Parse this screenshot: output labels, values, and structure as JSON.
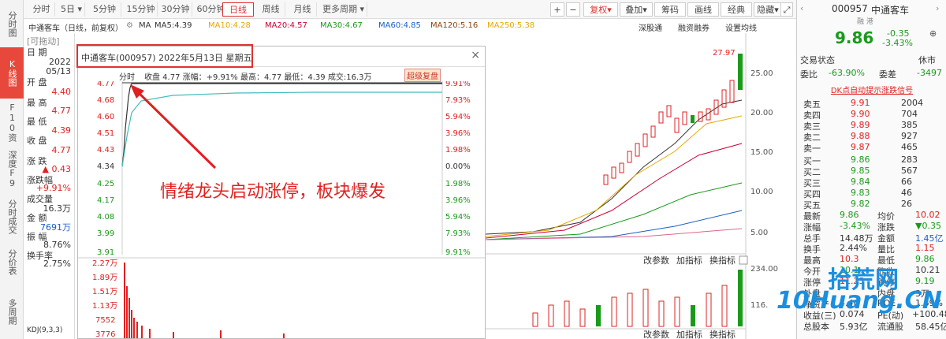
{
  "left_nav": [
    {
      "label": "分时图"
    },
    {
      "label": "K线图",
      "active": true
    },
    {
      "label": "F10资料"
    },
    {
      "label": "深度F9"
    },
    {
      "label": "分时成交"
    },
    {
      "label": "分价表"
    },
    {
      "label": "多周期"
    }
  ],
  "toolbar": {
    "periods": [
      "分时",
      "5日",
      "5分钟",
      "15分钟",
      "30分钟",
      "60分钟",
      "日线",
      "周线",
      "月线",
      "更多周期"
    ],
    "right": [
      "+",
      "−",
      "复权",
      "叠加",
      "筹码",
      "画线",
      "经典",
      "隐藏"
    ]
  },
  "indicator_row": {
    "title": "中通客车（日线，前复权）",
    "ma_label": "MA",
    "ma5": "MA5:4.39",
    "ma10": "MA10:4.28",
    "ma20": "MA20:4.57",
    "ma30": "MA30:4.67",
    "ma60": "MA60:4.85",
    "ma120": "MA120:5.16",
    "ma250": "MA250:5.38",
    "links": [
      "深股通",
      "融资融券",
      "设置均线"
    ]
  },
  "info": {
    "drag": "[可拖动]",
    "date_label": "日  期",
    "date_year": "2022",
    "date_md": "05/13",
    "open_label": "开  盘",
    "open": "4.40",
    "high_label": "最  高",
    "high": "4.77",
    "low_label": "最  低",
    "low": "4.39",
    "close_label": "收  盘",
    "close": "4.77",
    "chg_label": "涨  跌",
    "chg": "0.43",
    "pct_label": "涨跌幅",
    "pct": "+9.91%",
    "vol_label": "成交量",
    "vol": "16.3万",
    "amt_label": "金  额",
    "amt": "7691万",
    "amp_label": "振  幅",
    "amp": "8.76%",
    "turn_label": "换手率",
    "turn": "2.75%",
    "kdj": "KDJ(9,3,3)"
  },
  "popup": {
    "title": "中通客车(000957) 2022年5月13日 星期五",
    "tab": "分时",
    "summary": "收盘 4.77 涨幅：+9.91% 最高：4.77 最低：4.39 成交:16.3万",
    "super": "超级复盘",
    "annotation": "情绪龙头启动涨停，板块爆发",
    "y_left": [
      "4.77",
      "4.68",
      "4.60",
      "4.51",
      "4.43",
      "4.34",
      "4.25",
      "4.17",
      "4.08",
      "3.99",
      "3.91"
    ],
    "y_right": [
      "9.91%",
      "7.93%",
      "5.94%",
      "3.96%",
      "1.98%",
      "0.00%",
      "1.98%",
      "3.96%",
      "5.94%",
      "7.93%",
      "9.91%"
    ],
    "vol_axis": [
      "2.27万",
      "1.89万",
      "1.51万",
      "1.13万",
      "7552",
      "3776"
    ]
  },
  "kchart": {
    "high_price": "27.97",
    "axis": [
      "25.00",
      "20.00",
      "15.00",
      "10.00",
      "5.00"
    ],
    "bottom_bar": [
      "改参数",
      "加指标",
      "换指标"
    ],
    "vol_axis": [
      "234.00",
      "116."
    ]
  },
  "rp": {
    "code": "000957",
    "name": "中通客车",
    "tag": "融  港",
    "price": "9.86",
    "chg": "-0.35",
    "pct": "-3.43%",
    "status_label": "交易状态",
    "status": "休市",
    "wb_label": "委比",
    "wb": "-63.90%",
    "wc_label": "委差",
    "wc": "-3497",
    "promo": "DK点自动提示涨跌信号",
    "sells": [
      {
        "l": "卖五",
        "p": "9.91",
        "v": "2004"
      },
      {
        "l": "卖四",
        "p": "9.90",
        "v": "704"
      },
      {
        "l": "卖三",
        "p": "9.89",
        "v": "385"
      },
      {
        "l": "卖二",
        "p": "9.88",
        "v": "927"
      },
      {
        "l": "卖一",
        "p": "9.87",
        "v": "465"
      }
    ],
    "buys": [
      {
        "l": "买一",
        "p": "9.86",
        "v": "283"
      },
      {
        "l": "买二",
        "p": "9.85",
        "v": "567"
      },
      {
        "l": "买三",
        "p": "9.84",
        "v": "66"
      },
      {
        "l": "买四",
        "p": "9.83",
        "v": "46"
      },
      {
        "l": "买五",
        "p": "9.82",
        "v": "26"
      }
    ],
    "stats": [
      {
        "a": "最新",
        "av": "9.86",
        "b": "均价",
        "bv": "10.02"
      },
      {
        "a": "涨幅",
        "av": "-3.43%",
        "b": "涨跌",
        "bv": "▼0.35"
      },
      {
        "a": "总手",
        "av": "14.48万",
        "b": "金额",
        "bv": "1.45亿"
      },
      {
        "a": "换手",
        "av": "2.44%",
        "b": "量比",
        "bv": "1.15"
      },
      {
        "a": "最高",
        "av": "10.3",
        "b": "最低",
        "bv": "9.86"
      },
      {
        "a": "今开",
        "av": "10.1",
        "b": "昨收",
        "bv": "10.21"
      },
      {
        "a": "涨停",
        "av": "11.23",
        "b": "跌停",
        "bv": "9.19"
      },
      {
        "a": "外盘",
        "av": "",
        "b": "内盘",
        "bv": "3万"
      },
      {
        "a": "净资产",
        "av": "4.40",
        "b": "ROE",
        "bv": "1.69%"
      },
      {
        "a": "收益(三)",
        "av": "0.074",
        "b": "PE(动)",
        "bv": "+100.48"
      },
      {
        "a": "总股本",
        "av": "5.93亿",
        "b": "流通股",
        "bv": "58.45亿"
      }
    ]
  },
  "watermark": {
    "cn": "拾荒网",
    "en": "10Huang.CN"
  },
  "colors": {
    "red": "#e02020",
    "green": "#1a9a1a",
    "blue": "#1a5fc8"
  }
}
